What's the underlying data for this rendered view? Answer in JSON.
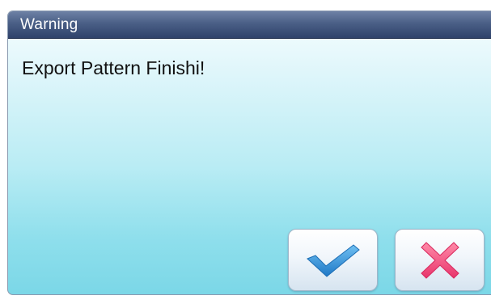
{
  "dialog": {
    "title": "Warning",
    "message": "Export Pattern Finishi!",
    "ok_icon": "checkmark-icon",
    "cancel_icon": "x-mark-icon",
    "colors": {
      "titlebar": "#3b4f78",
      "body_gradient_top": "#f7feff",
      "body_gradient_bottom": "#7bd7e7",
      "check": "#2f8fd6",
      "cross": "#f0477b"
    }
  }
}
